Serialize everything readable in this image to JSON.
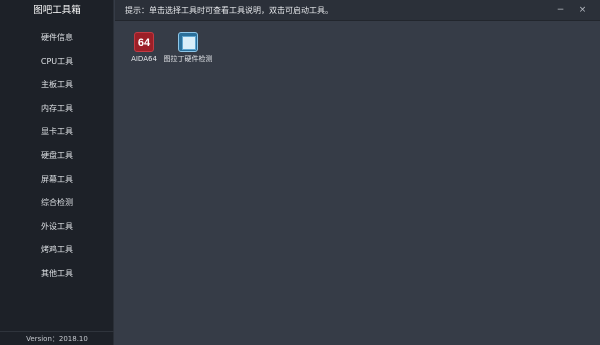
{
  "sidebar": {
    "title": "图吧工具箱",
    "items": [
      {
        "label": "硬件信息"
      },
      {
        "label": "CPU工具"
      },
      {
        "label": "主板工具"
      },
      {
        "label": "内存工具"
      },
      {
        "label": "显卡工具"
      },
      {
        "label": "硬盘工具"
      },
      {
        "label": "屏幕工具"
      },
      {
        "label": "综合检测"
      },
      {
        "label": "外设工具"
      },
      {
        "label": "烤鸡工具"
      },
      {
        "label": "其他工具"
      }
    ],
    "version": "Version：2018.10"
  },
  "topbar": {
    "hint": "提示：单击选择工具时可查看工具说明，双击可启动工具。",
    "minimize_glyph": "−",
    "close_glyph": "×"
  },
  "tools": [
    {
      "name": "AIDA64",
      "icon_text": "64",
      "icon": "aida64-icon"
    },
    {
      "name": "图拉丁硬件检测",
      "icon": "tuba-hardware-check-icon"
    }
  ],
  "colors": {
    "sidebar_bg": "#1d2128",
    "content_bg": "#363c47",
    "topbar_bg": "#2b3039",
    "aida_red": "#9c1f27",
    "tuba_blue": "#2a6f9a"
  }
}
